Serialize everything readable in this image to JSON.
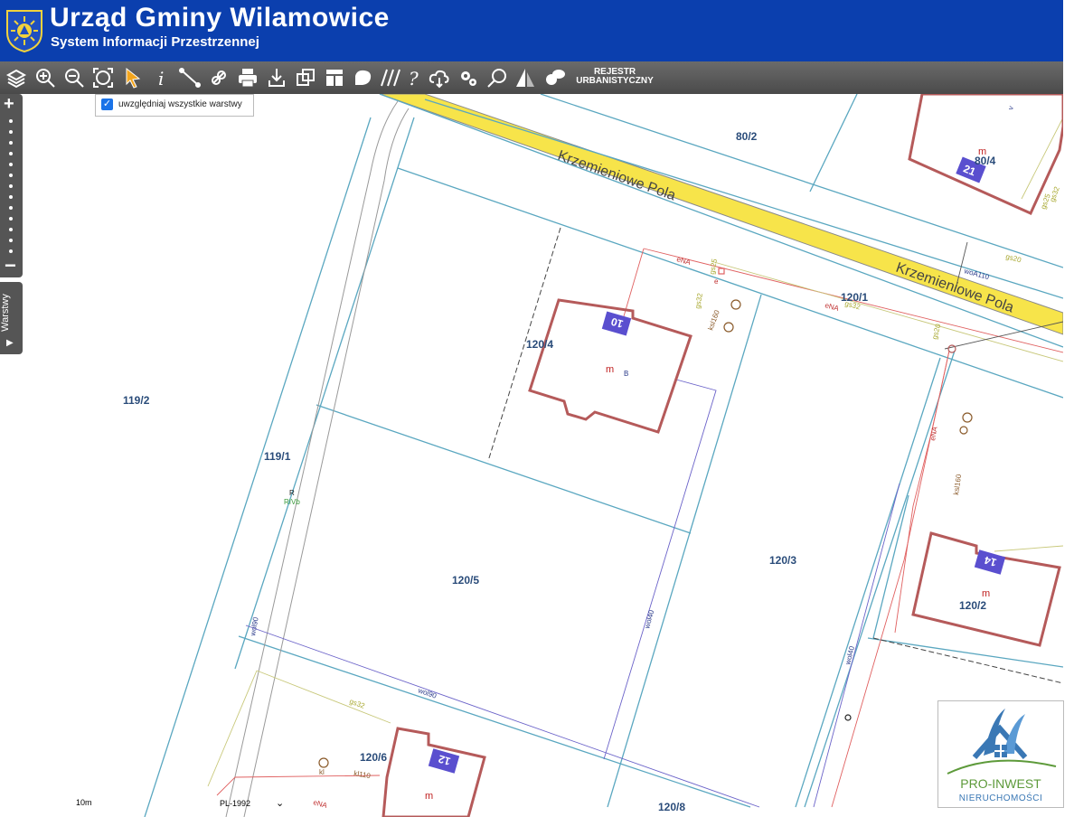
{
  "header": {
    "title": "Urząd Gminy Wilamowice",
    "subtitle": "System Informacji Przestrzennej"
  },
  "toolbar": {
    "icons": [
      "layers-icon",
      "zoom-in-icon",
      "zoom-out-icon",
      "zoom-extent-icon",
      "select-arrow-icon",
      "info-icon",
      "measure-distance-icon",
      "measure-area-icon",
      "print-icon",
      "download-icon",
      "copy-layers-icon",
      "layout-icon",
      "draw-polygon-icon",
      "hatch-icon",
      "help-icon",
      "cloud-icon",
      "settings-icon",
      "search-icon",
      "compare-icon",
      "chat-icon"
    ],
    "rejestr_line1": "REJESTR",
    "rejestr_line2": "URBANISTYCZNY"
  },
  "layer_panel": {
    "checkbox_checked": true,
    "label": "uwzględniaj wszystkie warstwy"
  },
  "side": {
    "zoom_in": "+",
    "zoom_out": "−",
    "layers_tab": "Warstwy"
  },
  "map": {
    "streets": [
      {
        "name": "Krzemieniowe Pola"
      },
      {
        "name": "Krzemieniowe Pola"
      }
    ],
    "parcels": [
      "80/2",
      "80/4",
      "119/2",
      "119/1",
      "120/4",
      "120/1",
      "120/5",
      "120/3",
      "120/2",
      "120/6",
      "120/8"
    ],
    "house_numbers": [
      "21",
      "10",
      "14",
      "12"
    ],
    "building_marks": [
      "m",
      "m",
      "m",
      "m",
      "B"
    ],
    "utility_labels": [
      "eNA",
      "gs25",
      "gs32",
      "ksl160",
      "ksl160",
      "eNA",
      "gs32",
      "gs20",
      "woA110",
      "eNA",
      "gs25",
      "gs32",
      "wol90",
      "wol40",
      "wol90",
      "wol40",
      "gs32",
      "kl110",
      "kl",
      "eNA",
      "e",
      "gs20",
      "R",
      "RIVb",
      "v"
    ]
  },
  "logo": {
    "name": "PRO-INWEST",
    "sub": "NIERUCHOMOŚCI"
  },
  "footer": {
    "scale": "10m",
    "crs": "PL-1992"
  },
  "colors": {
    "header_bg": "#0b3fae",
    "road_fill": "#f7e44a",
    "parcel_line": "#5aa7c0",
    "building": "#b55a5a",
    "house_number_bg": "#5a4fcf"
  }
}
